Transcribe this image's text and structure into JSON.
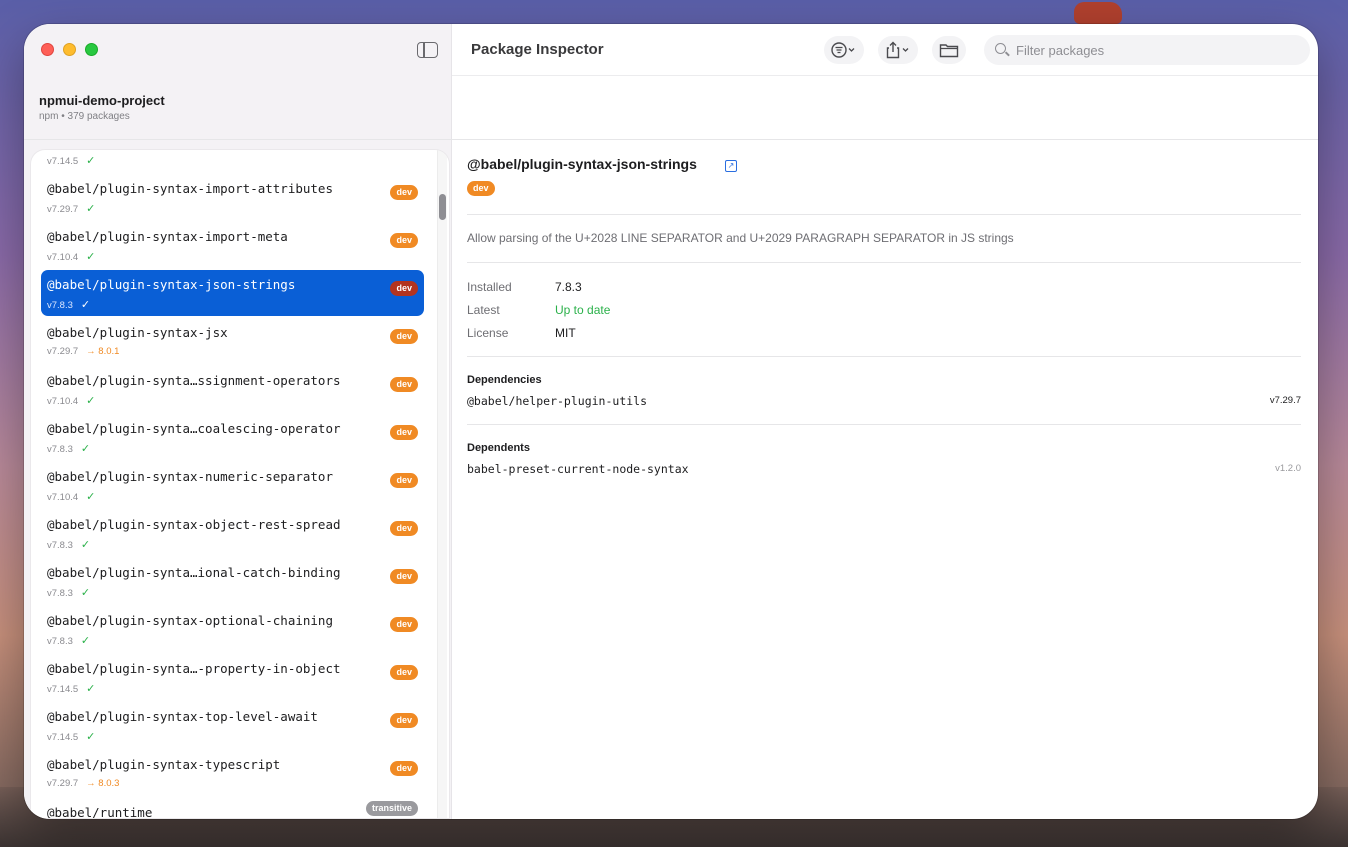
{
  "window": {
    "title": "Package Inspector"
  },
  "project": {
    "name": "npmui-demo-project",
    "meta": "npm • 379 packages"
  },
  "search": {
    "placeholder": "Filter packages"
  },
  "toolbar": {
    "filter_icon": "filter-menu-icon",
    "share_icon": "share-icon",
    "folder_icon": "folder-icon"
  },
  "packages": [
    {
      "name": "",
      "version": "v7.14.5",
      "status": "ok",
      "badge": ""
    },
    {
      "name": "@babel/plugin-syntax-import-attributes",
      "version": "v7.29.7",
      "status": "ok",
      "badge": "dev"
    },
    {
      "name": "@babel/plugin-syntax-import-meta",
      "version": "v7.10.4",
      "status": "ok",
      "badge": "dev"
    },
    {
      "name": "@babel/plugin-syntax-json-strings",
      "version": "v7.8.3",
      "status": "ok",
      "badge": "dev",
      "selected": true
    },
    {
      "name": "@babel/plugin-syntax-jsx",
      "version": "v7.29.7",
      "status": "update",
      "update": "→ 8.0.1",
      "badge": "dev"
    },
    {
      "name": "@babel/plugin-synta…ssignment-operators",
      "version": "v7.10.4",
      "status": "ok",
      "badge": "dev"
    },
    {
      "name": "@babel/plugin-synta…coalescing-operator",
      "version": "v7.8.3",
      "status": "ok",
      "badge": "dev"
    },
    {
      "name": "@babel/plugin-syntax-numeric-separator",
      "version": "v7.10.4",
      "status": "ok",
      "badge": "dev"
    },
    {
      "name": "@babel/plugin-syntax-object-rest-spread",
      "version": "v7.8.3",
      "status": "ok",
      "badge": "dev"
    },
    {
      "name": "@babel/plugin-synta…ional-catch-binding",
      "version": "v7.8.3",
      "status": "ok",
      "badge": "dev"
    },
    {
      "name": "@babel/plugin-syntax-optional-chaining",
      "version": "v7.8.3",
      "status": "ok",
      "badge": "dev"
    },
    {
      "name": "@babel/plugin-synta…-property-in-object",
      "version": "v7.14.5",
      "status": "ok",
      "badge": "dev"
    },
    {
      "name": "@babel/plugin-syntax-top-level-await",
      "version": "v7.14.5",
      "status": "ok",
      "badge": "dev"
    },
    {
      "name": "@babel/plugin-syntax-typescript",
      "version": "v7.29.7",
      "status": "update",
      "update": "→ 8.0.3",
      "badge": "dev"
    },
    {
      "name": "@babel/runtime",
      "version": "",
      "status": "none",
      "badge": "transitive"
    }
  ],
  "detail": {
    "name": "@babel/plugin-syntax-json-strings",
    "badge": "dev",
    "description": "Allow parsing of the U+2028 LINE SEPARATOR and U+2029 PARAGRAPH SEPARATOR in JS strings",
    "fields": [
      {
        "label": "Installed",
        "value": "7.8.3"
      },
      {
        "label": "Latest",
        "value": "Up to date"
      },
      {
        "label": "License",
        "value": "MIT"
      }
    ],
    "dependencies_title": "Dependencies",
    "dependencies": [
      {
        "name": "@babel/helper-plugin-utils",
        "version": "v7.29.7"
      }
    ],
    "dependents_title": "Dependents",
    "dependents": [
      {
        "name": "babel-preset-current-node-syntax",
        "version": "v1.2.0"
      }
    ]
  },
  "colors": {
    "accent": "#0a5fd6",
    "dev_badge": "#f08a24",
    "ok": "#2bb14a",
    "update": "#f08a24"
  }
}
